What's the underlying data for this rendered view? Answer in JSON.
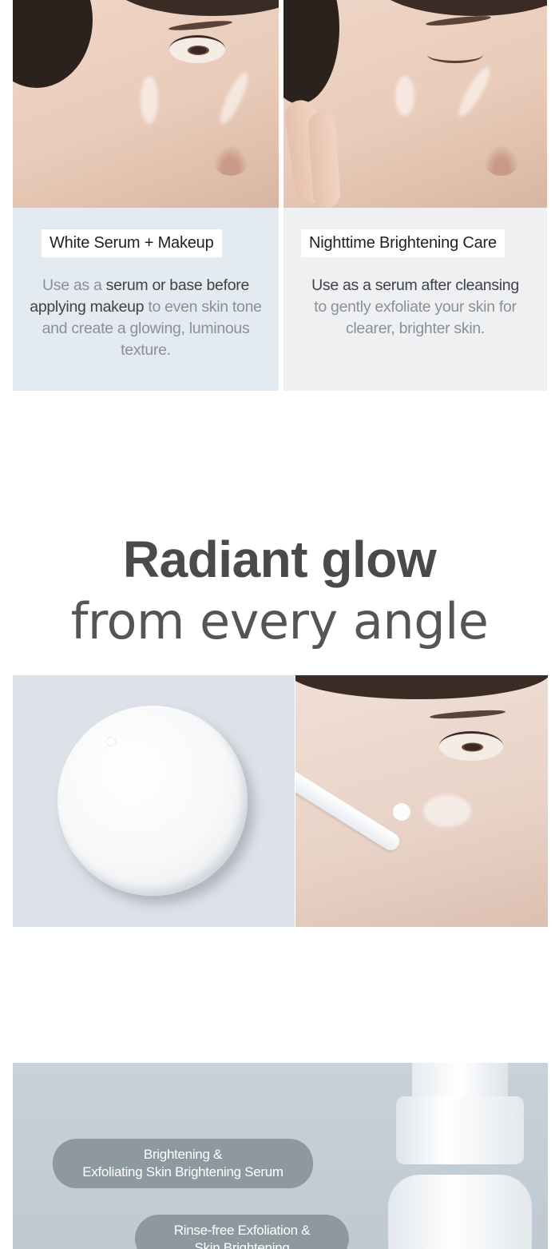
{
  "usage_cards": [
    {
      "title": "White Serum + Makeup",
      "desc": [
        {
          "text": "Use as a ",
          "bold": false
        },
        {
          "text": "serum or base before applying makeup",
          "bold": true
        },
        {
          "text": " to even skin tone and create a glowing, luminous texture.",
          "bold": false
        }
      ]
    },
    {
      "title": "Nighttime Brightening Care",
      "desc": [
        {
          "text": "Use as a serum after cleansing",
          "bold": true
        },
        {
          "text": " to gently exfoliate your skin for clearer, brighter skin.",
          "bold": false
        }
      ]
    }
  ],
  "headline": {
    "bold": "Radiant glow",
    "light": "from every angle"
  },
  "product": {
    "badge_1": "Brightening & Exfoliating Skin Brightening Serum",
    "badge_1_line1": "Brightening &",
    "badge_1_line2": "Exfoliating Skin Brightening Serum",
    "badge_2_line1": "Rinse-free Exfoliation &",
    "badge_2_line2": "Skin Brightening"
  },
  "colors": {
    "left_panel_bg": "#e3ebf0",
    "right_panel_bg": "#eef0f2",
    "badge_bg": "#8e989f",
    "headline": "#4a4a4a"
  }
}
